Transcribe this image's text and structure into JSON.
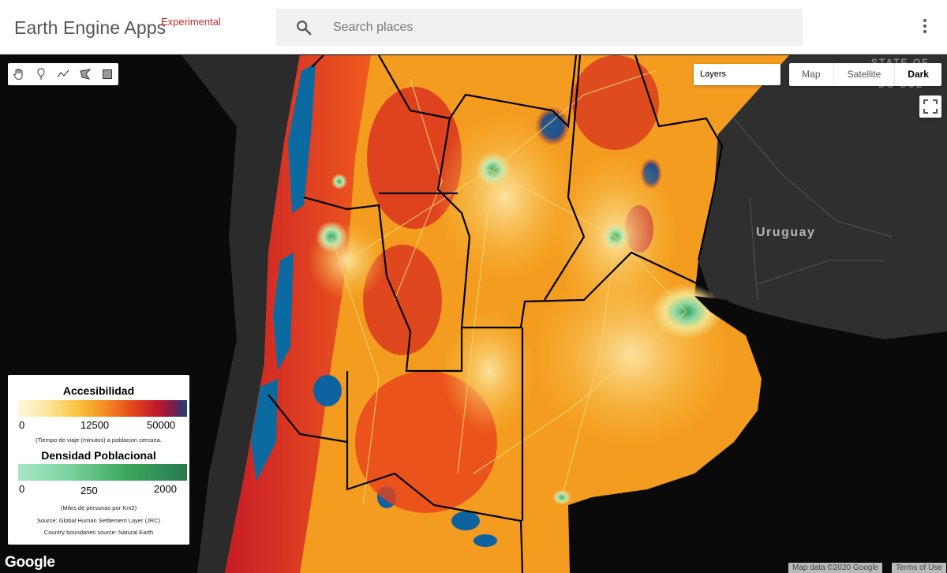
{
  "header": {
    "brand": "Earth Engine Apps",
    "badge": "Experimental",
    "search_placeholder": "Search places",
    "search_icon": "search-icon",
    "menu_icon": "more-vert-icon"
  },
  "map": {
    "labels": {
      "uruguay": "Uruguay",
      "state_line1": "STATE OF",
      "state_line2": "DO SUL"
    },
    "layers_label": "Layers",
    "map_types": [
      "Map",
      "Satellite",
      "Dark"
    ],
    "selected_map_type": "Dark",
    "drawing_tools": [
      "hand-pan-icon",
      "marker-icon",
      "polyline-icon",
      "polygon-icon",
      "rectangle-icon"
    ],
    "fullscreen_icon": "fullscreen-icon",
    "attribution_data": "Map data ©2020 Google",
    "attribution_terms": "Terms of Use",
    "logo": "Google"
  },
  "legend": {
    "accessibility": {
      "title": "Accesibilidad",
      "ticks": [
        "0",
        "12500",
        "50000"
      ],
      "note": "(Tiempo de viaje (minutos) a poblacion cercana."
    },
    "density": {
      "title": "Densidad Poblacional",
      "ticks": [
        "0",
        "250",
        "2000"
      ],
      "note": "(Miles de personas por Km2)"
    },
    "source1": "Source: Global Human Settlement Layer (JRC)",
    "source2": "Country boundaries source: Natural Earth"
  },
  "colors": {
    "accessibility_ramp": [
      "#fff6dc",
      "#fbc33e",
      "#e3461c",
      "#1f3f78"
    ],
    "density_ramp": [
      "#a8e6c7",
      "#3aa65a",
      "#2a7a52"
    ],
    "badge": "#c62828"
  }
}
